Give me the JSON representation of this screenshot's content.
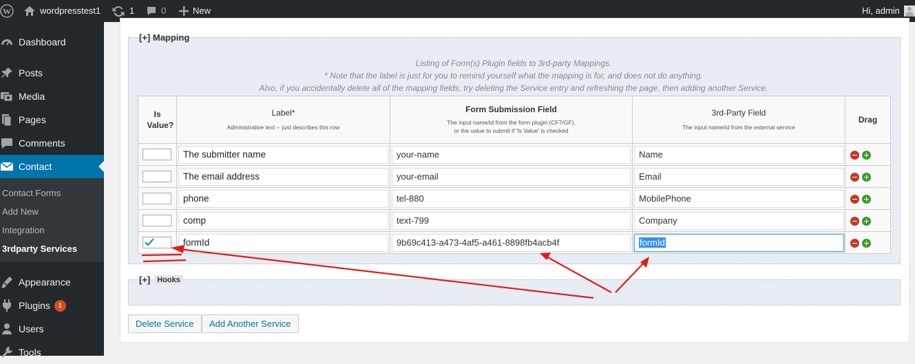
{
  "adminbar": {
    "site_name": "wordpresstest1",
    "updates_count": "1",
    "comments_count": "0",
    "new_label": "New",
    "greeting": "Hi, admin"
  },
  "sidebar": {
    "items": [
      {
        "label": "Dashboard",
        "icon": "dashboard-icon"
      },
      {
        "label": "Posts",
        "icon": "pin-icon"
      },
      {
        "label": "Media",
        "icon": "media-icon"
      },
      {
        "label": "Pages",
        "icon": "pages-icon"
      },
      {
        "label": "Comments",
        "icon": "comment-icon"
      },
      {
        "label": "Contact",
        "icon": "mail-icon"
      },
      {
        "label": "Appearance",
        "icon": "brush-icon"
      },
      {
        "label": "Plugins",
        "icon": "plug-icon",
        "badge": "1"
      },
      {
        "label": "Users",
        "icon": "user-icon"
      },
      {
        "label": "Tools",
        "icon": "wrench-icon"
      }
    ],
    "submenu": [
      "Contact Forms",
      "Add New",
      "Integration",
      "3rdparty Services"
    ]
  },
  "mapping": {
    "legend": "[+] Mapping",
    "notes": [
      "Listing of Form(s) Plugin fields to 3rd-party Mappings.",
      "* Note that the label is just for you to remind yourself what the mapping is for, and does not do anything.",
      "Also, if you accidentally delete all of the mapping fields, try deleting the Service entry and refreshing the page, then adding another Service."
    ],
    "headers": {
      "is_value": "Is Value?",
      "label": "Label*",
      "label_sub": "Administrative text -- just describes this row",
      "form_field": "Form Submission Field",
      "form_field_sub1": "The input name/id from the form plugin (CF7/GF),",
      "form_field_sub2": "or the value to submit if 'Is Value' is checked",
      "third_party": "3rd-Party Field",
      "third_party_sub": "The input name/id from the external service",
      "drag": "Drag"
    },
    "rows": [
      {
        "checked": false,
        "label": "The submitter name",
        "src": "your-name",
        "dest": "Name"
      },
      {
        "checked": false,
        "label": "The email address",
        "src": "your-email",
        "dest": "Email"
      },
      {
        "checked": false,
        "label": "phone",
        "src": "tel-880",
        "dest": "MobilePhone"
      },
      {
        "checked": false,
        "label": "comp",
        "src": "text-799",
        "dest": "Company"
      },
      {
        "checked": true,
        "label": "formId",
        "src": "9b69c413-a473-4af5-a461-8898fb4acb4f",
        "dest": "formId"
      }
    ]
  },
  "hooks": {
    "prefix": "[+]",
    "legend": "Hooks"
  },
  "buttons": {
    "delete": "Delete Service",
    "add": "Add Another Service"
  },
  "annotation_color": "#e31b1b"
}
